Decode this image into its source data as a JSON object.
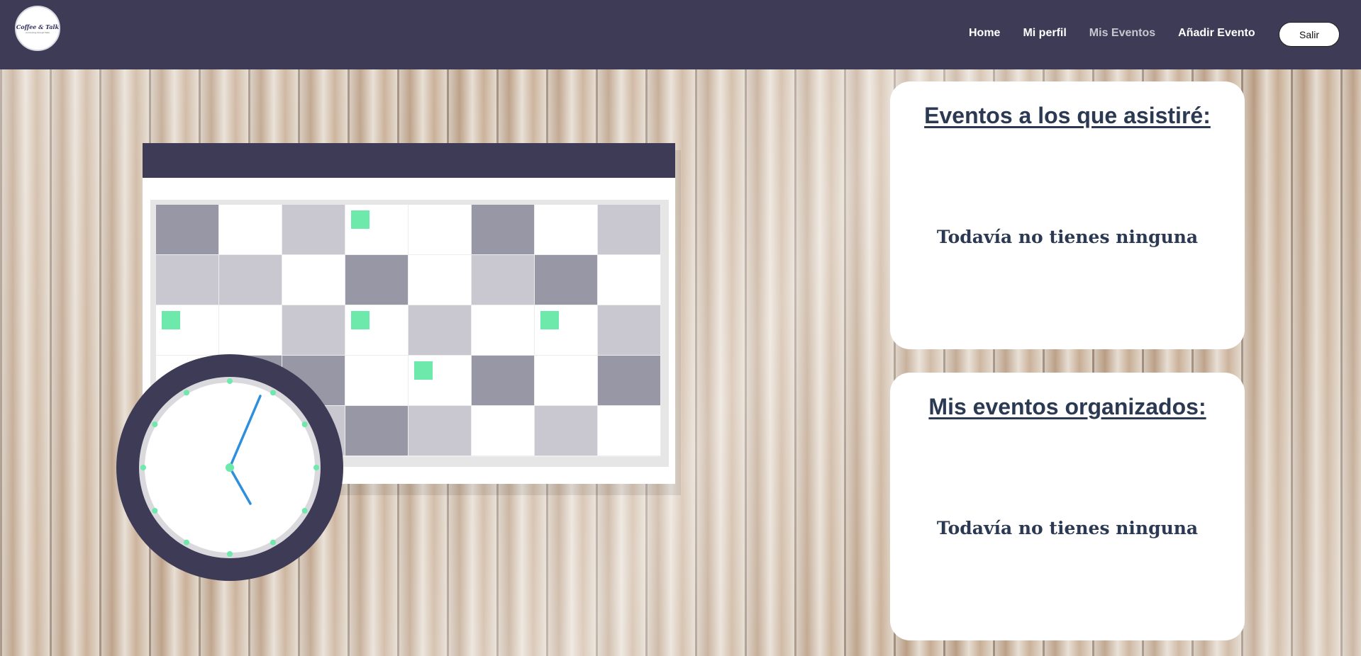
{
  "navbar": {
    "logo": {
      "title": "Coffee & Talk",
      "subtitle": "Connecting through Talks"
    },
    "links": [
      {
        "label": "Home",
        "active": false
      },
      {
        "label": "Mi perfil",
        "active": false
      },
      {
        "label": "Mis Eventos",
        "active": true
      },
      {
        "label": "Añadir Evento",
        "active": false
      }
    ],
    "logout_label": "Salir"
  },
  "cards": {
    "attending": {
      "title": "Eventos a los que asistiré:",
      "empty_message": "Todavía no tienes ninguna"
    },
    "organized": {
      "title": "Mis eventos organizados:",
      "empty_message": "Todavía no tienes ninguna"
    }
  },
  "colors": {
    "navbar_bg": "#3e3b57",
    "accent_green": "#6ee9ac",
    "clock_hand": "#2e8fdc",
    "heading_text": "#2b3a52"
  },
  "illustration": {
    "icons": [
      "calendar-icon",
      "clock-icon"
    ]
  }
}
